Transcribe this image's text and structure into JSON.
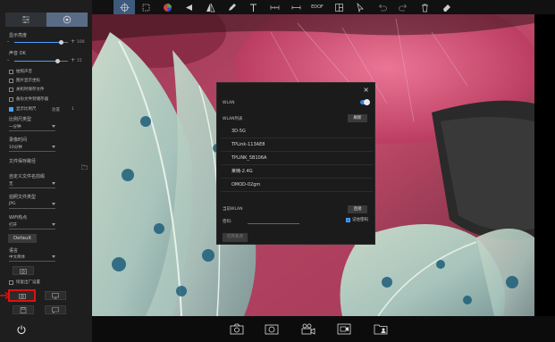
{
  "sidebar": {
    "brightness_label": "显示亮度",
    "brightness_max": "100",
    "brightness_value": 0.88,
    "volume_label": "声音",
    "volume_state": "OK",
    "volume_max": "15",
    "volume_value": 0.8,
    "checkboxes": [
      {
        "label": "拍照声音",
        "checked": false
      },
      {
        "label": "图片显示坐标",
        "checked": false
      },
      {
        "label": "关机时保存文件",
        "checked": false
      },
      {
        "label": "备份文件到储存器",
        "checked": false
      },
      {
        "label": "显示比例尺",
        "checked": true,
        "extra": "放置",
        "extra2": "1"
      }
    ],
    "ratio_label": "比例尺类型",
    "ratio_value": "一分钟",
    "record_time_label": "录像时间",
    "record_time_value": "10分钟",
    "save_path_label": "文件保存路径",
    "custom_name_label": "自定义文件名前缀",
    "custom_name_value": "无",
    "format_label": "拍照文件类型",
    "format_value": "JPG",
    "wifi_label": "WiFi热点",
    "wifi_value": "打开",
    "default_button": "Default",
    "language_label": "语言",
    "language_value": "中文简体",
    "factory_reset_label": "恢复出厂设置"
  },
  "toolbar": {
    "edof_label": "EDOF",
    "icons": [
      "crosshair-icon",
      "crop-icon",
      "color-icon",
      "triangle-icon",
      "compare-icon",
      "pen-icon",
      "text-icon",
      "measure-icon",
      "line-measure-icon",
      "edof-icon",
      "split-icon",
      "cursor-icon",
      "undo-icon",
      "redo-icon",
      "delete-icon",
      "eraser-icon"
    ]
  },
  "bottombar": {
    "icons": [
      "camera-icon",
      "camera-alt-icon",
      "video-icon",
      "record-icon",
      "folder-user-icon"
    ]
  },
  "dialog": {
    "close": "×",
    "wlan_label": "WLAN",
    "wlan_on": true,
    "list_label": "WLAN列表",
    "refresh_button": "刷新",
    "networks": [
      "3D-5G",
      "TPLink-113AE8",
      "TPLINK_5B106A",
      "莱楠-2.4G",
      "OMOD-02gm",
      "..."
    ],
    "current_label": "当前WLAN",
    "connect_button": "连接",
    "password_label": "密码:",
    "show_password_label": "记住密码",
    "show_password_checked": true,
    "bottom_button": "打开热点"
  },
  "colors": {
    "accent": "#3d7fd6",
    "highlight_border": "#e01010",
    "sidebar_bg": "#1e1e1e"
  }
}
